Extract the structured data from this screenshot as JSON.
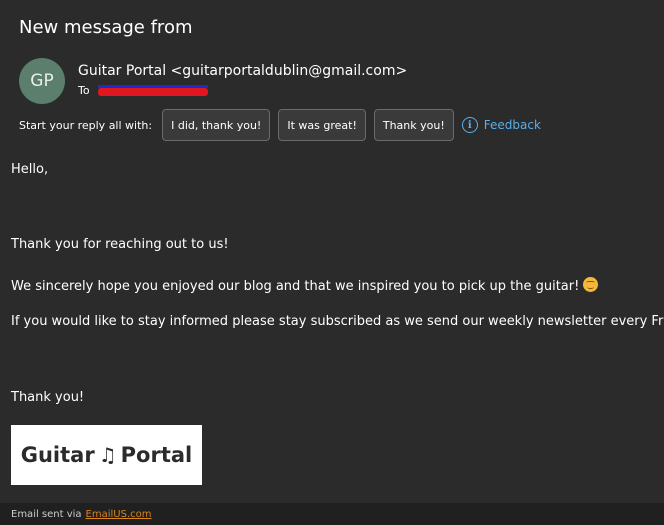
{
  "header": {
    "subject": "New message from"
  },
  "sender": {
    "initials": "GP",
    "avatar_color": "#5b7e6d",
    "display": "Guitar Portal <guitarportaldublin@gmail.com>",
    "to_label": "To"
  },
  "quick_reply": {
    "label": "Start your reply all with:",
    "options": [
      "I did, thank you!",
      "It was great!",
      "Thank you!"
    ],
    "feedback_label": "Feedback"
  },
  "message": {
    "greeting": "Hello,",
    "line1": "Thank you for reaching out to us!",
    "line2": "We sincerely hope you enjoyed our blog and that we inspired you to pick up the guitar!",
    "line3": "If you would like to stay informed please stay subscribed as we send our weekly newsletter every Friday!",
    "signoff": "Thank you!"
  },
  "logo": {
    "word1": "Guitar",
    "note_glyph": "♫",
    "word2": "Portal"
  },
  "footer": {
    "text": "Email sent via",
    "link": "EmailUS.com",
    "link_color": "#d9841e"
  },
  "colors": {
    "background": "#2b2b2b",
    "accent": "#5aaeea"
  }
}
